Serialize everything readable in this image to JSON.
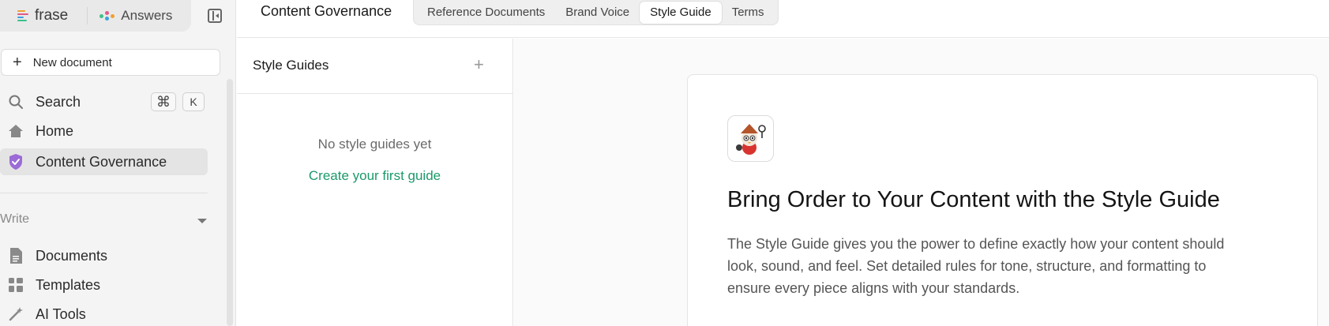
{
  "sidebar": {
    "brand": "frase",
    "answers_label": "Answers",
    "new_document": "New document",
    "search": {
      "label": "Search",
      "shortcut_cmd": "⌘",
      "shortcut_key": "K"
    },
    "home": "Home",
    "content_governance": "Content Governance",
    "write_section": "Write",
    "documents": "Documents",
    "templates": "Templates",
    "ai_tools": "AI Tools"
  },
  "topbar": {
    "title": "Content Governance",
    "tabs": [
      {
        "label": "Reference Documents"
      },
      {
        "label": "Brand Voice"
      },
      {
        "label": "Style Guide"
      },
      {
        "label": "Terms"
      }
    ],
    "active_tab": "Style Guide"
  },
  "panel": {
    "title": "Style Guides",
    "add_symbol": "+",
    "empty_message": "No style guides yet",
    "create_link": "Create your first guide"
  },
  "main": {
    "heading": "Bring Order to Your Content with the Style Guide",
    "description": "The Style Guide gives you the power to define exactly how your content should look, sound, and feel. Set detailed rules for tone, structure, and formatting to ensure every piece aligns with your standards."
  },
  "colors": {
    "accent_green": "#1a9a6a",
    "governance_purple": "#9b6bd6",
    "sidebar_bg": "#f4f4f4"
  }
}
